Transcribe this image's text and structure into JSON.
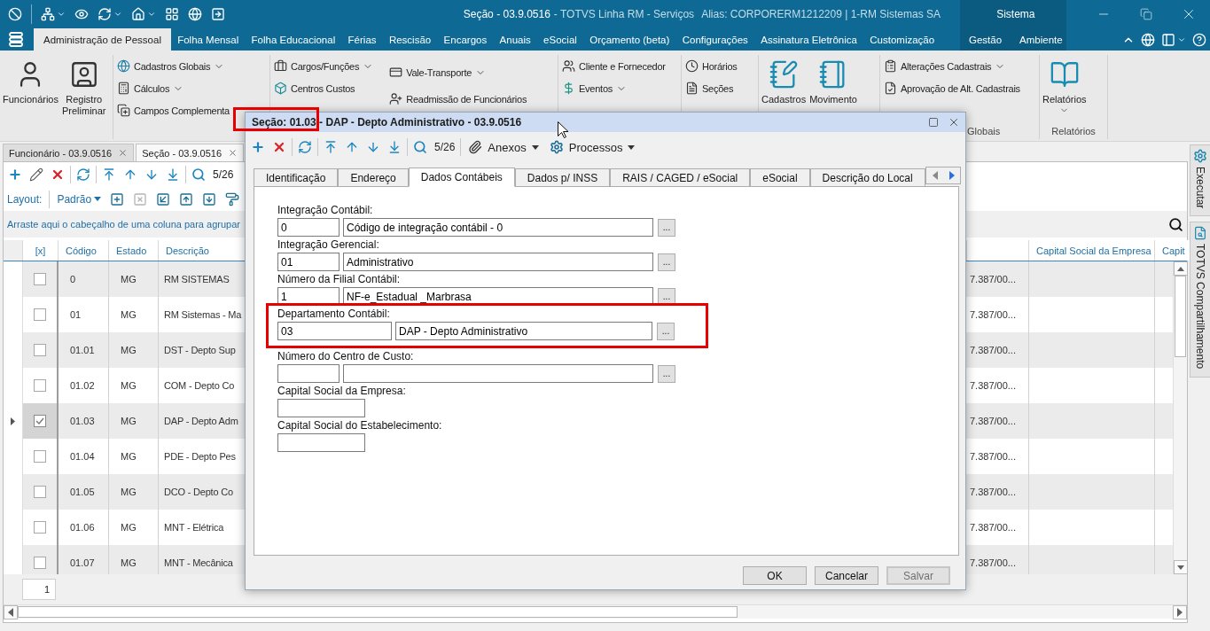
{
  "window": {
    "document": "Seção - 03.9.0516",
    "product": "- TOTVS Linha RM - Serviços",
    "alias": "Alias: CORPORERM1212209 | 1-RM Sistemas SA",
    "system": "Sistema"
  },
  "menu": {
    "tabs": [
      {
        "label": "Administração de Pessoal",
        "selected": true
      },
      {
        "label": "Folha Mensal",
        "selected": false
      },
      {
        "label": "Folha Educacional",
        "selected": false
      },
      {
        "label": "Férias",
        "selected": false
      },
      {
        "label": "Rescisão",
        "selected": false
      },
      {
        "label": "Encargos",
        "selected": false
      },
      {
        "label": "Anuais",
        "selected": false
      },
      {
        "label": "eSocial",
        "selected": false
      },
      {
        "label": "Orçamento (beta)",
        "selected": false
      },
      {
        "label": "Configurações",
        "selected": false
      },
      {
        "label": "Assinatura Eletrônica",
        "selected": false
      },
      {
        "label": "Customização",
        "selected": false
      }
    ],
    "system_tabs": [
      {
        "label": "Gestão",
        "selected": false
      },
      {
        "label": "Ambiente",
        "selected": false
      }
    ]
  },
  "ribbon": {
    "groups": [
      {
        "kind": "large",
        "columns": [
          [
            {
              "label": "Funcionários",
              "dropdown": false
            },
            {
              "label": "Registro Preliminar",
              "dropdown": false
            }
          ]
        ]
      },
      {
        "kind": "small",
        "columns": [
          [
            {
              "label": "Cadastros Globais",
              "dropdown": true
            },
            {
              "label": "Cálculos",
              "dropdown": true
            },
            {
              "label": "Campos Complementa",
              "dropdown": false
            }
          ]
        ]
      },
      {
        "kind": "small",
        "columns": [
          [
            {
              "label": "Cargos/Funções",
              "dropdown": true
            },
            {
              "label": "Centros Custos",
              "dropdown": false
            }
          ],
          [
            {
              "label": "Vale-Transporte",
              "dropdown": true
            },
            {
              "label": "Readmissão de Funcionários",
              "dropdown": false
            }
          ]
        ]
      },
      {
        "kind": "small",
        "columns": [
          [
            {
              "label": "Cliente e Fornecedor",
              "dropdown": false
            },
            {
              "label": "Eventos",
              "dropdown": true
            }
          ]
        ]
      },
      {
        "kind": "small",
        "columns": [
          [
            {
              "label": "Horários",
              "dropdown": false
            },
            {
              "label": "Seções",
              "dropdown": false
            }
          ]
        ]
      },
      {
        "kind": "large",
        "columns": [
          [
            {
              "label": "Cadastros",
              "dropdown": false
            },
            {
              "label": "Movimento",
              "dropdown": false
            }
          ]
        ]
      },
      {
        "kind": "small",
        "label": "Globais",
        "columns": [
          [
            {
              "label": "Alterações Cadastrais",
              "dropdown": true
            },
            {
              "label": "Aprovação de Alt. Cadastrais",
              "dropdown": false
            }
          ]
        ]
      },
      {
        "kind": "large",
        "label": "Relatórios",
        "columns": [
          [
            {
              "label": "Relatórios",
              "dropdown": true
            }
          ]
        ]
      }
    ]
  },
  "document_tabs": [
    {
      "label": "Funcionário - 03.9.0516",
      "selected": false
    },
    {
      "label": "Seção - 03.9.0516",
      "selected": true
    }
  ],
  "grid_toolbar": {
    "counter": "5/26"
  },
  "layout_bar": {
    "label": "Layout:",
    "value": "Padrão"
  },
  "group_panel": {
    "hint": "Arraste aqui o cabeçalho de uma coluna para agrupar"
  },
  "grid": {
    "columns": [
      "[x]",
      "Código",
      "Estado",
      "Descrição",
      "Capital Social da Empresa",
      "Capit"
    ],
    "rows": [
      {
        "checked": false,
        "selected": false,
        "code": "0",
        "state": "MG",
        "description": "RM SISTEMAS",
        "column_5": "7.387/00..."
      },
      {
        "checked": false,
        "selected": false,
        "code": "01",
        "state": "MG",
        "description": "RM Sistemas - Ma",
        "column_5": "7.387/00..."
      },
      {
        "checked": false,
        "selected": false,
        "code": "01.01",
        "state": "MG",
        "description": "DST - Depto Sup",
        "column_5": "7.387/00..."
      },
      {
        "checked": false,
        "selected": false,
        "code": "01.02",
        "state": "MG",
        "description": "COM - Depto Co",
        "column_5": "7.387/00..."
      },
      {
        "checked": true,
        "selected": true,
        "code": "01.03",
        "state": "MG",
        "description": "DAP - Depto Adm",
        "column_5": "7.387/00..."
      },
      {
        "checked": false,
        "selected": false,
        "code": "01.04",
        "state": "MG",
        "description": "PDE - Depto Pes",
        "column_5": "7.387/00..."
      },
      {
        "checked": false,
        "selected": false,
        "code": "01.05",
        "state": "MG",
        "description": "DCO - Depto Co",
        "column_5": "7.387/00..."
      },
      {
        "checked": false,
        "selected": false,
        "code": "01.06",
        "state": "MG",
        "description": "MNT - Elétrica",
        "column_5": "7.387/00..."
      },
      {
        "checked": false,
        "selected": false,
        "code": "01.07",
        "state": "MG",
        "description": "MNT - Mecânica",
        "column_5": "7.387/00..."
      }
    ]
  },
  "pager": {
    "page": "1"
  },
  "side_tabs": [
    "Executar",
    "TOTVS Compartilhamento"
  ],
  "dialog": {
    "title": "Seção: 01.03 - DAP - Depto Administrativo - 03.9.0516",
    "toolbar": {
      "counter": "5/26",
      "menus": [
        "Anexos",
        "Processos"
      ]
    },
    "tabs": [
      {
        "label": "Identificação",
        "selected": false
      },
      {
        "label": "Endereço",
        "selected": false
      },
      {
        "label": "Dados Contábeis",
        "selected": true
      },
      {
        "label": "Dados p/ INSS",
        "selected": false
      },
      {
        "label": "RAIS / CAGED / eSocial",
        "selected": false
      },
      {
        "label": "eSocial",
        "selected": false
      },
      {
        "label": "Descrição do Local",
        "selected": false
      }
    ],
    "fields": [
      {
        "kind": "lookup",
        "label": "Integração Contábil:",
        "code": "0",
        "description": "Código de integração contábil - 0",
        "button": "..."
      },
      {
        "kind": "lookup",
        "label": "Integração Gerencial:",
        "code": "01",
        "description": "Administrativo",
        "button": "..."
      },
      {
        "kind": "lookup",
        "label": "Número da Filial Contábil:",
        "code": "1",
        "description": "NF-e_Estadual _Marbrasa",
        "button": "..."
      },
      {
        "kind": "widelookup",
        "label": "Departamento Contábil:",
        "code": "03",
        "description": "DAP - Depto Administrativo",
        "button": "..."
      },
      {
        "kind": "lookup",
        "label": "Número do Centro de Custo:",
        "button": "..."
      },
      {
        "kind": "text",
        "label": "Capital Social da Empresa:"
      },
      {
        "kind": "text",
        "label": "Capital Social do Estabelecimento:"
      }
    ],
    "buttons": [
      {
        "label": "OK",
        "disabled": false
      },
      {
        "label": "Cancelar",
        "disabled": false
      },
      {
        "label": "Salvar",
        "disabled": true
      }
    ]
  }
}
